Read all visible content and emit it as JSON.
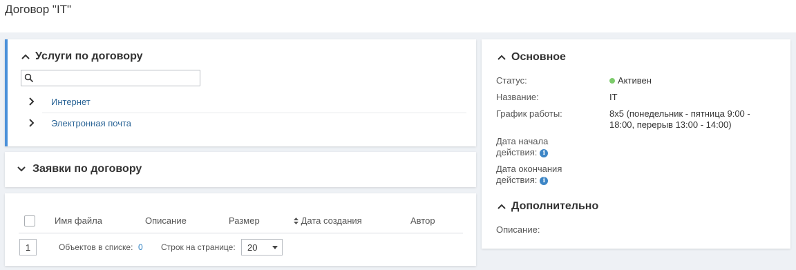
{
  "page": {
    "title": "Договор \"IT\""
  },
  "services": {
    "title": "Услуги по договору",
    "search_placeholder": "",
    "items": [
      {
        "label": "Интернет"
      },
      {
        "label": "Электронная почта"
      }
    ]
  },
  "requests": {
    "title": "Заявки по договору"
  },
  "files": {
    "columns": [
      "Имя файла",
      "Описание",
      "Размер",
      "Дата создания",
      "Автор"
    ],
    "page_number": "1",
    "objects_label": "Объектов в списке:",
    "objects_count": "0",
    "rows_per_page_label": "Строк на странице:",
    "rows_per_page_value": "20"
  },
  "main": {
    "title": "Основное",
    "status_label": "Статус:",
    "status_value": "Активен",
    "status_color": "#7ccb6b",
    "name_label": "Название:",
    "name_value": "IT",
    "schedule_label": "График работы:",
    "schedule_value_1": "8x5 (понедельник - пятница 9:00 -",
    "schedule_value_2": "18:00, перерыв 13:00 - 14:00)",
    "start_label_1": "Дата начала",
    "start_label_2": "действия:",
    "end_label_1": "Дата окончания",
    "end_label_2": "действия:"
  },
  "extra": {
    "title": "Дополнительно",
    "description_label": "Описание:"
  },
  "colors": {
    "accent": "#4a90d9",
    "link": "#2a6496",
    "info": "#3d86c6"
  }
}
